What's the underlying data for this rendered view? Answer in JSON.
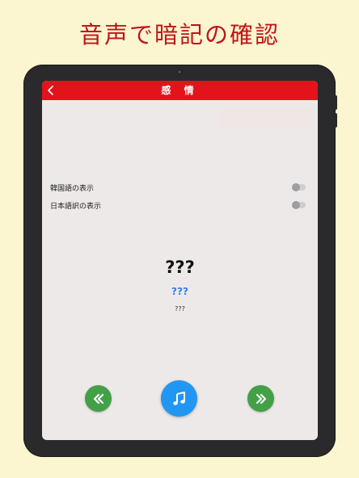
{
  "headline": "音声で暗記の確認",
  "screen": {
    "title": "感 情",
    "back_icon": "chevron-left-icon"
  },
  "toggles": [
    {
      "label": "韓国語の表示",
      "on": false
    },
    {
      "label": "日本語訳の表示",
      "on": false
    }
  ],
  "card": {
    "word": "???",
    "reading": "???",
    "meaning": "???"
  },
  "controls": {
    "prev_icon": "double-chevron-left-icon",
    "play_icon": "music-note-icon",
    "next_icon": "double-chevron-right-icon"
  },
  "colors": {
    "background": "#fbf6cf",
    "headline": "#c0141b",
    "topbar": "#e3131b",
    "screen": "#ede9e8",
    "nav_button": "#43a047",
    "play_button": "#2196f3",
    "reading_text": "#2f80ed"
  }
}
